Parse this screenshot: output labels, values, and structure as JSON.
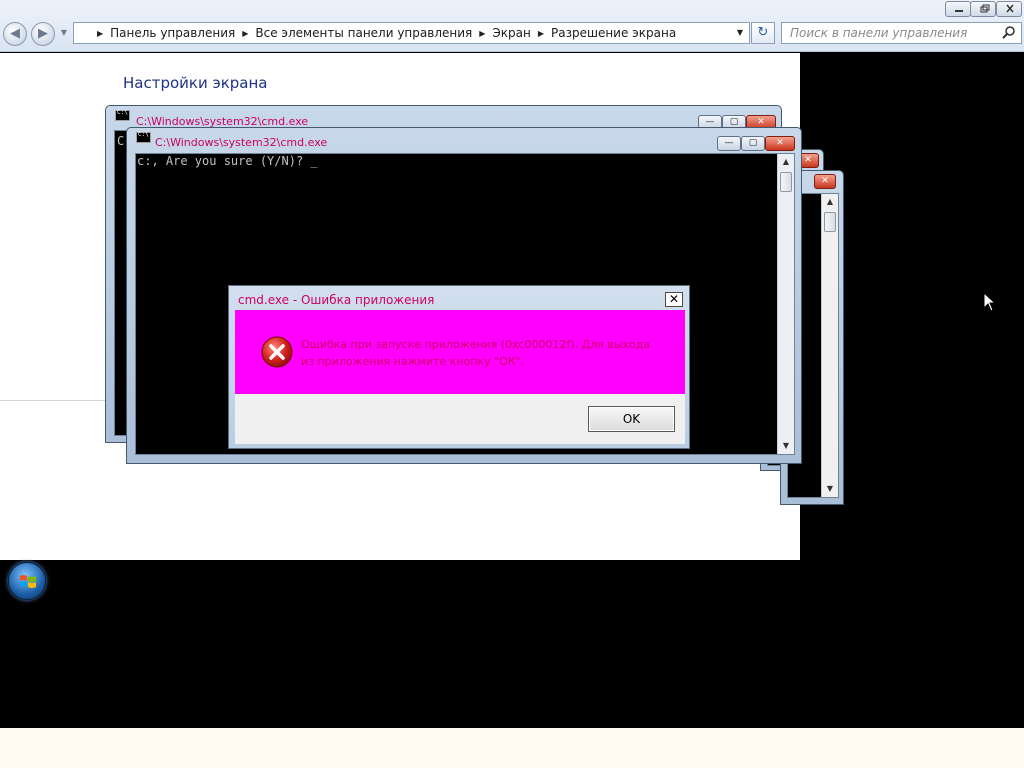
{
  "explorer": {
    "breadcrumb": [
      "Панель управления",
      "Все элементы панели управления",
      "Экран",
      "Разрешение экрана"
    ],
    "search_placeholder": "Поиск в панели управления",
    "content_title": "Настройки экрана"
  },
  "cmd_windows": [
    {
      "title": "C:\\Windows\\system32\\cmd.exe",
      "prompt_fragment": "C"
    },
    {
      "title": "C:\\Windows\\system32\\cmd.exe",
      "terminal_line": "c:, Are you sure (Y/N)? _"
    }
  ],
  "error_dialog": {
    "title": "cmd.exe - Ошибка приложения",
    "message": "Ошибка при запуске приложения (0xc000012f). Для выхода из приложения нажмите кнопку \"ОК\".",
    "ok_label": "OK",
    "message_bg_color": "#ff00ff",
    "title_color": "#cc0066"
  },
  "icons": [
    "back-icon",
    "forward-icon",
    "search-icon",
    "refresh-icon",
    "error-icon",
    "windows-flag-icon",
    "cursor-icon"
  ]
}
